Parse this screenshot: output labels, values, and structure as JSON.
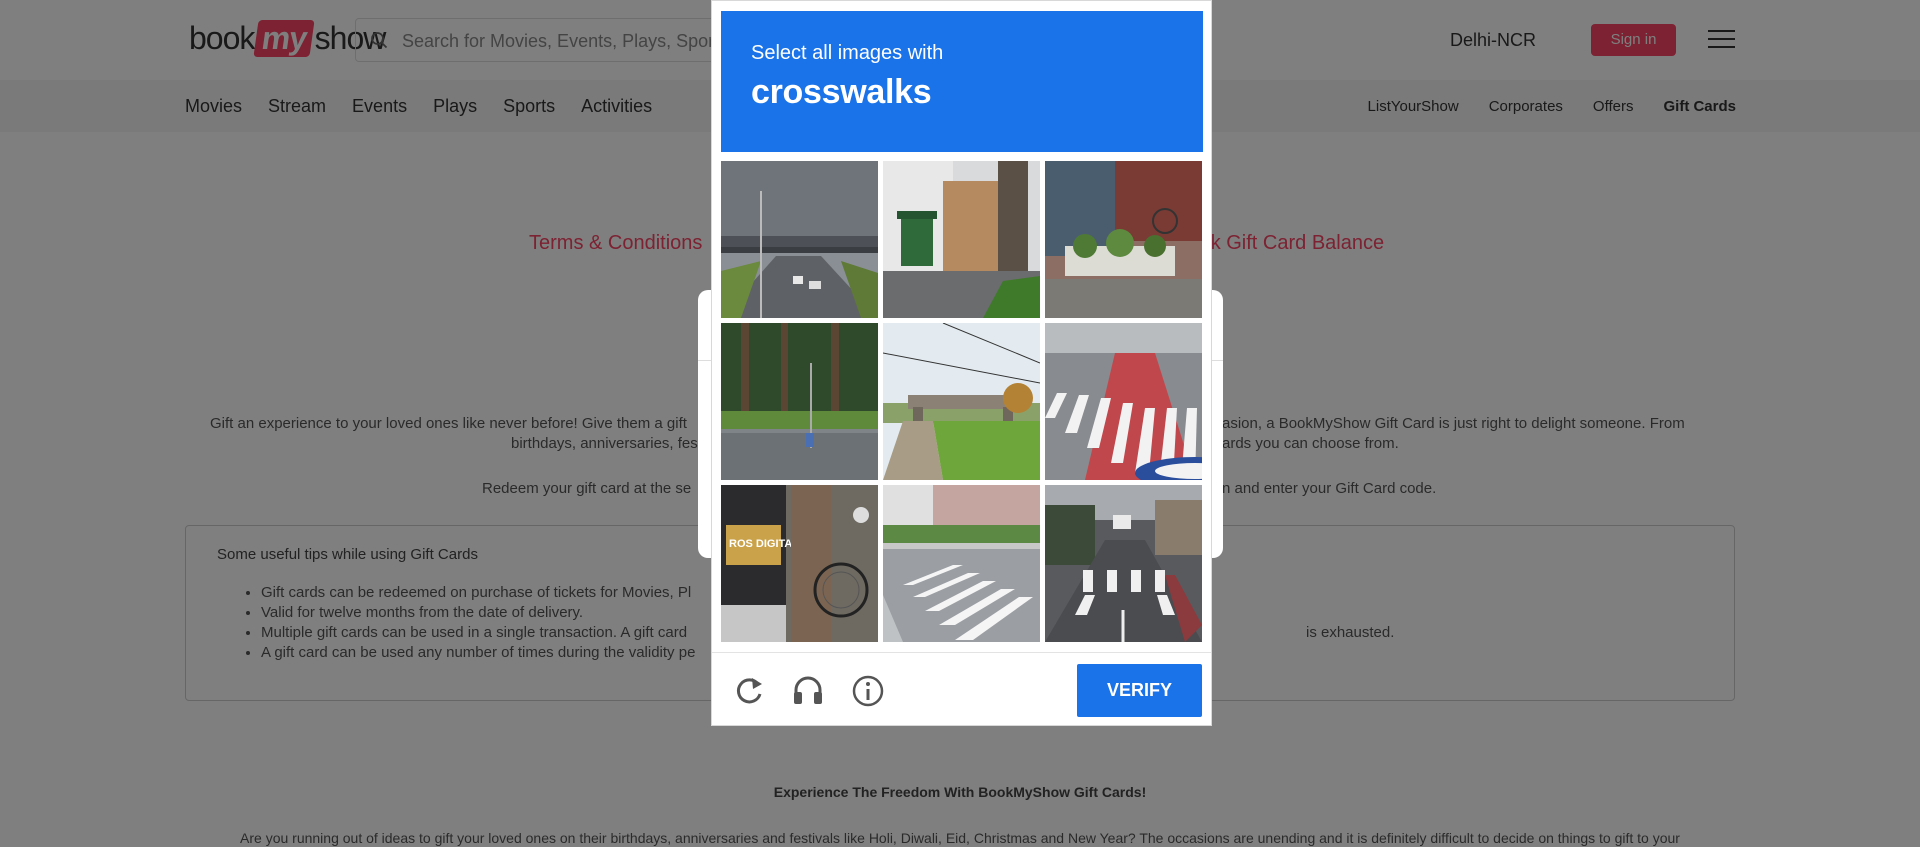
{
  "header": {
    "logo": {
      "left": "book",
      "mid": "my",
      "right": "show"
    },
    "search_placeholder": "Search for Movies, Events, Plays, Sports and Activities",
    "city": "Delhi-NCR",
    "signin_label": "Sign in"
  },
  "nav": {
    "left": [
      "Movies",
      "Stream",
      "Events",
      "Plays",
      "Sports",
      "Activities"
    ],
    "right": [
      "ListYourShow",
      "Corporates",
      "Offers",
      "Gift Cards"
    ]
  },
  "page": {
    "terms_link": "Terms & Conditions",
    "balance_link": "Check Gift Card Balance",
    "intro_line1_left": "Gift an experience to your loved ones like never before! Give them a gift",
    "intro_line1_right": "asion, a BookMyShow Gift Card is just right to delight someone. From",
    "intro_line2_left": "birthdays, anniversaries, fes",
    "intro_line2_right": "ards you can choose from.",
    "redeem_left": "Redeem your gift card at the se",
    "redeem_right": "n and enter your Gift Card code.",
    "tips_title": "Some useful tips while using Gift Cards",
    "tips": [
      "Gift cards can be redeemed on purchase of tickets for Movies, Pl",
      "Valid for twelve months from the date of delivery.",
      "Multiple gift cards can be used in a single transaction. A gift card",
      "A gift card can be used any number of times during the validity pe"
    ],
    "tips_tail": "is exhausted.",
    "footer_title": "Experience The Freedom With BookMyShow Gift Cards!",
    "footer_para": "Are you running out of ideas to gift your loved ones on their birthdays, anniversaries and festivals like Holi, Diwali, Eid, Christmas and New Year? The occasions are unending and it is definitely difficult to decide on things to gift to your"
  },
  "captcha": {
    "prompt": "Select all images with",
    "target": "crosswalks",
    "tiles": [
      "highway-overpass-road",
      "trash-bin-by-fence",
      "potted-plants-by-shed",
      "road-intersection-with-trees",
      "dirt-path-under-bridge",
      "crosswalk-with-red-bike-lane",
      "tree-with-bicycle-and-poster",
      "crosswalk-on-residential-street",
      "crosswalk-on-urban-road"
    ],
    "verify_label": "VERIFY",
    "icons": [
      "reload-icon",
      "audio-icon",
      "info-icon"
    ]
  },
  "colors": {
    "brand": "#f84464",
    "captcha_blue": "#1a73e8"
  }
}
